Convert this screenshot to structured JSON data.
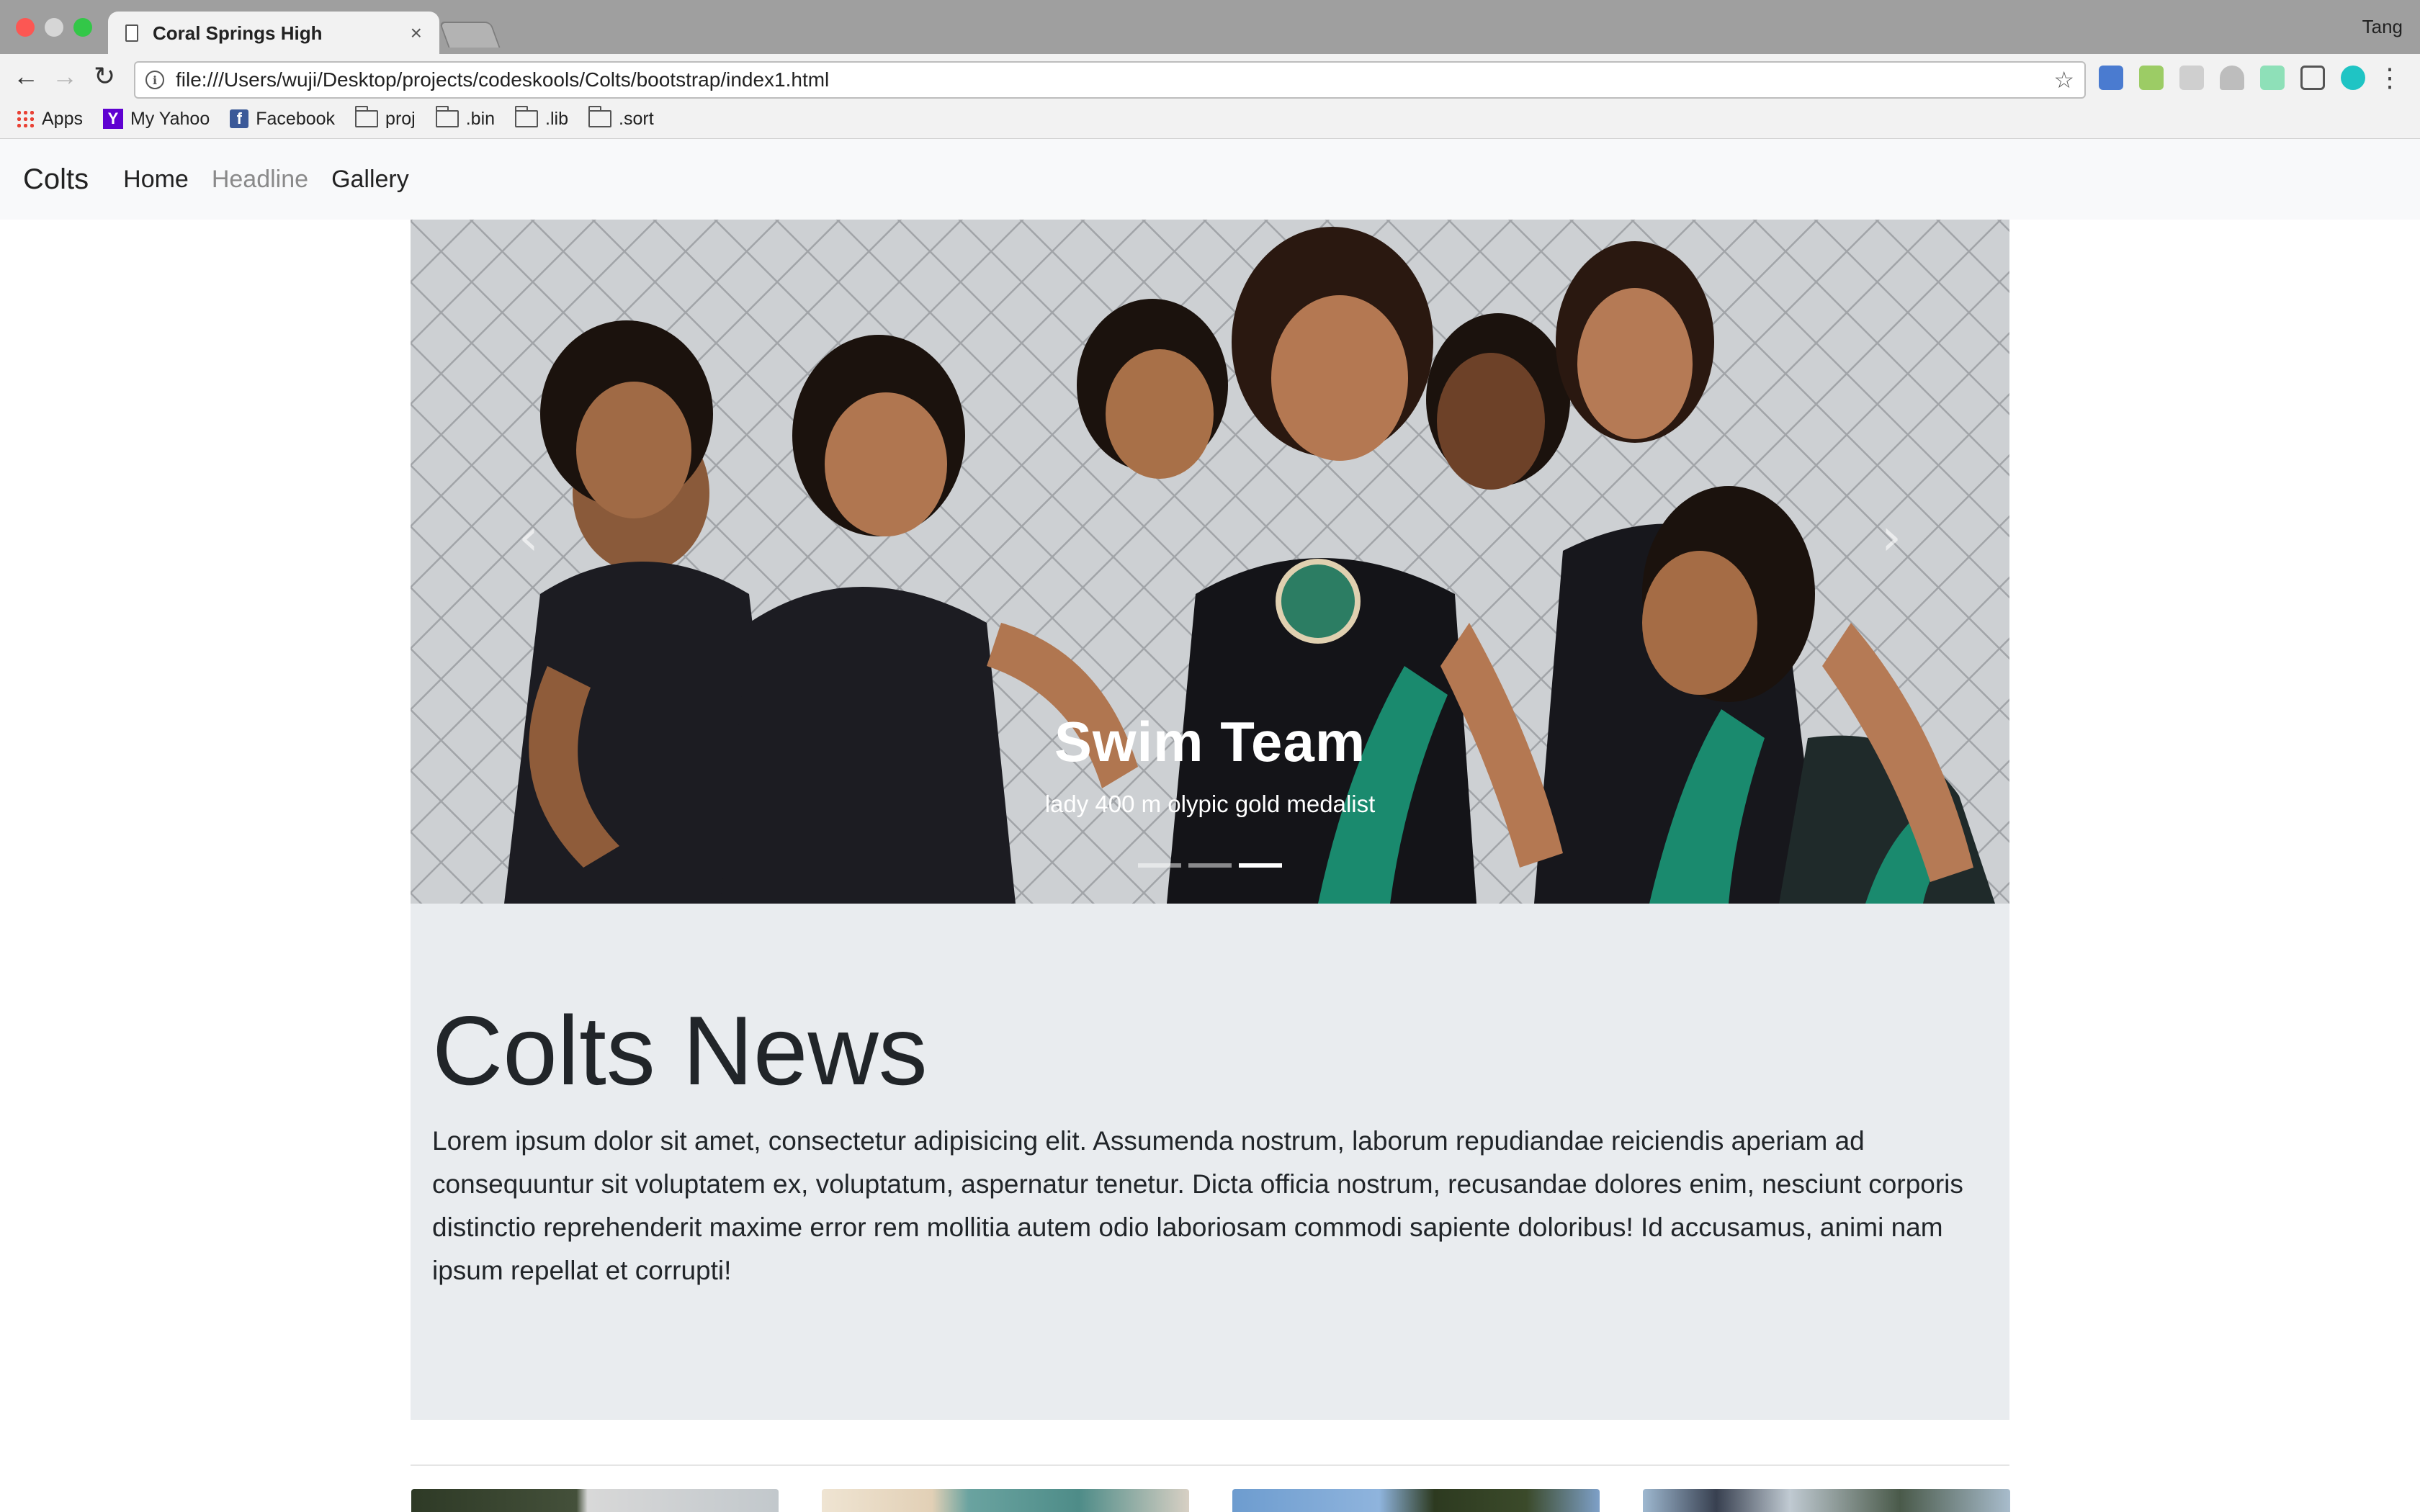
{
  "browser": {
    "tab_title": "Coral Springs High",
    "profile_name": "Tang",
    "url": "file:///Users/wuji/Desktop/projects/codeskools/Colts/bootstrap/index1.html",
    "bookmarks": [
      {
        "label": "Apps",
        "icon": "apps-grid-icon"
      },
      {
        "label": "My Yahoo",
        "icon": "yahoo-icon"
      },
      {
        "label": "Facebook",
        "icon": "facebook-icon"
      },
      {
        "label": "proj",
        "icon": "folder-icon"
      },
      {
        "label": ".bin",
        "icon": "folder-icon"
      },
      {
        "label": ".lib",
        "icon": "folder-icon"
      },
      {
        "label": ".sort",
        "icon": "folder-icon"
      }
    ]
  },
  "navbar": {
    "brand": "Colts",
    "links": [
      {
        "label": "Home",
        "active": false
      },
      {
        "label": "Headline",
        "active": true
      },
      {
        "label": "Gallery",
        "active": false
      }
    ]
  },
  "carousel": {
    "caption_title": "Swim Team",
    "caption_text": "lady 400 m olypic gold medalist",
    "slide_count": 3,
    "active_slide": 3
  },
  "jumbotron": {
    "title": "Colts News",
    "text": "Lorem ipsum dolor sit amet, consectetur adipisicing elit. Assumenda nostrum, laborum repudiandae reiciendis aperiam ad consequuntur sit voluptatem ex, voluptatum, aspernatur tenetur. Dicta officia nostrum, recusandae dolores enim, nesciunt corporis distinctio reprehenderit maxime error rem mollitia autem odio laboriosam commodi sapiente doloribus! Id accusamus, animi nam ipsum repellat et corrupti!"
  },
  "colors": {
    "navbar_bg": "#f8f9fa",
    "jumbotron_bg": "#e9ecef",
    "text": "#212529",
    "muted_link": "#8a8a8a",
    "swimsuit_green": "#1a8a6e"
  }
}
